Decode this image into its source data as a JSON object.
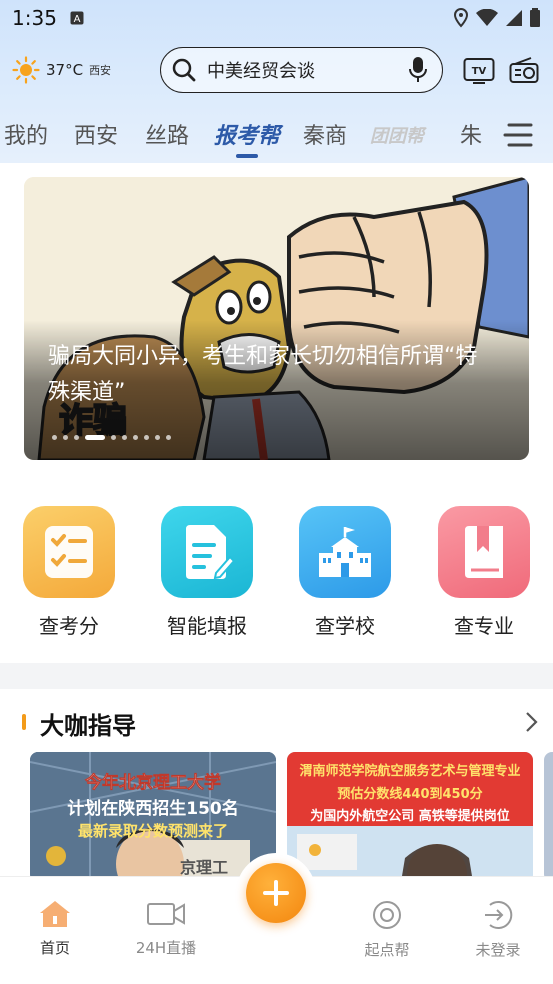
{
  "status_bar": {
    "time": "1:35"
  },
  "weather": {
    "temperature": "37°C",
    "city": "西安"
  },
  "search": {
    "query": "中美经贸会谈"
  },
  "channel_tabs": [
    {
      "label": "我的"
    },
    {
      "label": "西安"
    },
    {
      "label": "丝路"
    },
    {
      "label": "报考帮",
      "active": true
    },
    {
      "label": "秦商"
    },
    {
      "label": "团团帮"
    },
    {
      "label": "朱"
    }
  ],
  "banner": {
    "title": "骗局大同小异，考生和家长切勿相信所谓“特殊渠道”",
    "image_text": "诈骗",
    "slide_count": 10,
    "active_slide": 4
  },
  "quick_entries": [
    {
      "label": "查考分",
      "icon": "checklist-icon",
      "color": "#f7b84a"
    },
    {
      "label": "智能填报",
      "icon": "edit-document-icon",
      "color": "#27c7e0"
    },
    {
      "label": "查学校",
      "icon": "school-building-icon",
      "color": "#33a9f0"
    },
    {
      "label": "查专业",
      "icon": "bookmark-book-icon",
      "color": "#f47c88"
    }
  ],
  "section": {
    "title": "大咖指导",
    "cards": [
      {
        "lines": [
          "今年北京理工大学",
          "计划在陕西招生150名",
          "最新录取分数预测来了"
        ],
        "sign": "京理工"
      },
      {
        "lines": [
          "渭南师范学院航空服务艺术与管理专业",
          "预估分数线440到450分",
          "为国内外航空公司 高铁等提供岗位"
        ],
        "sign": ""
      }
    ]
  },
  "bottom_nav": [
    {
      "label": "首页",
      "icon": "home-icon",
      "active": true
    },
    {
      "label": "24H直播",
      "icon": "video-camera-icon"
    },
    {
      "label": "起点帮",
      "icon": "target-circle-icon"
    },
    {
      "label": "未登录",
      "icon": "login-arrow-icon"
    }
  ],
  "colors": {
    "accent_blue": "#2d5aa8",
    "accent_orange": "#f3860e"
  }
}
